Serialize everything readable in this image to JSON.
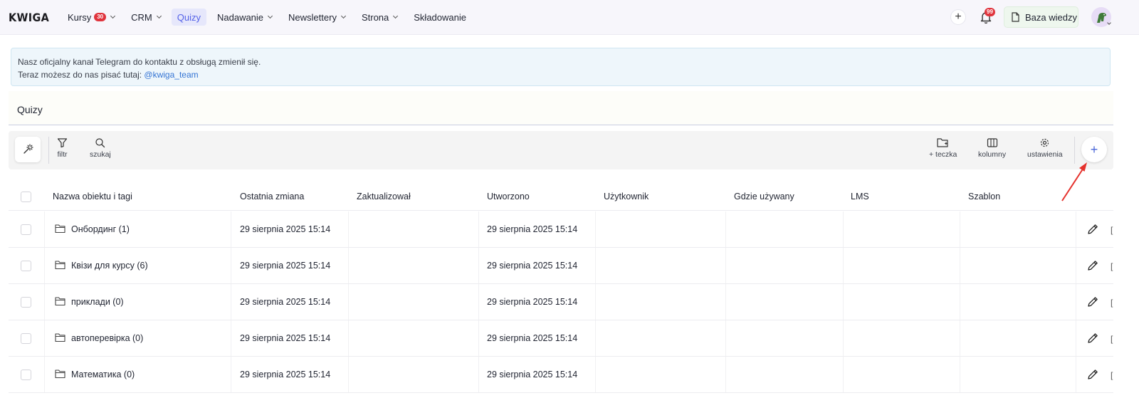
{
  "app": {
    "logo": "KWIGA"
  },
  "nav": {
    "items": [
      {
        "label": "Kursy",
        "badge": "30",
        "dropdown": true,
        "active": false
      },
      {
        "label": "CRM",
        "dropdown": true,
        "active": false
      },
      {
        "label": "Quizy",
        "dropdown": false,
        "active": true
      },
      {
        "label": "Nadawanie",
        "dropdown": true,
        "active": false
      },
      {
        "label": "Newslettery",
        "dropdown": true,
        "active": false
      },
      {
        "label": "Strona",
        "dropdown": true,
        "active": false
      },
      {
        "label": "Składowanie",
        "dropdown": false,
        "active": false
      }
    ],
    "plus_icon": "plus-icon",
    "notifications_badge": "99",
    "knowledge_base_label": "Baza wiedzy"
  },
  "notice": {
    "line1": "Nasz oficjalny kanał Telegram do kontaktu z obsługą zmienił się.",
    "line2_prefix": "Teraz możesz do nas pisać tutaj: ",
    "line2_link": "@kwiga_team"
  },
  "page": {
    "title": "Quizy"
  },
  "toolbar": {
    "filter_label": "filtr",
    "search_label": "szukaj",
    "folder_label": "+ teczka",
    "columns_label": "kolumny",
    "settings_label": "ustawienia",
    "add_icon": "plus-icon"
  },
  "table": {
    "columns": [
      "Nazwa obiektu i tagi",
      "Ostatnia zmiana",
      "Zaktualizował",
      "Utworzono",
      "Użytkownik",
      "Gdzie używany",
      "LMS",
      "Szablon"
    ],
    "rows": [
      {
        "name": "Онбординг (1)",
        "last_change": "29 sierpnia 2025 15:14",
        "updated_by": "",
        "created": "29 sierpnia 2025 15:14"
      },
      {
        "name": "Квізи для курсу (6)",
        "last_change": "29 sierpnia 2025 15:14",
        "updated_by": "",
        "created": "29 sierpnia 2025 15:14"
      },
      {
        "name": "приклади (0)",
        "last_change": "29 sierpnia 2025 15:14",
        "updated_by": "",
        "created": "29 sierpnia 2025 15:14"
      },
      {
        "name": "автоперевірка (0)",
        "last_change": "29 sierpnia 2025 15:14",
        "updated_by": "",
        "created": "29 sierpnia 2025 15:14"
      },
      {
        "name": "Математика (0)",
        "last_change": "29 sierpnia 2025 15:14",
        "updated_by": "",
        "created": "29 sierpnia 2025 15:14"
      }
    ]
  },
  "colors": {
    "accent": "#5563e8",
    "badge": "#e0343d",
    "annotation_arrow": "#e5322d"
  }
}
